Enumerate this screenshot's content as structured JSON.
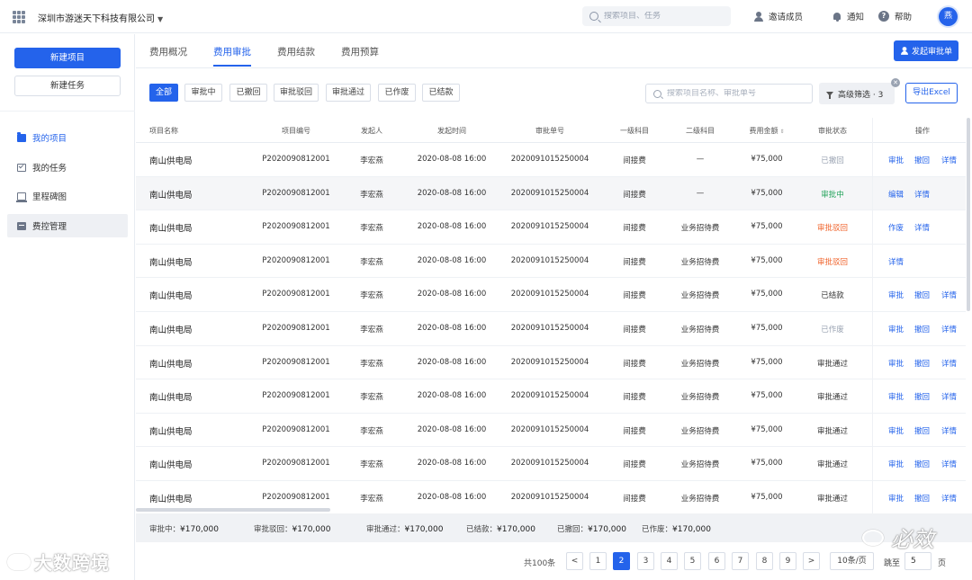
{
  "header": {
    "company": "深圳市游迷天下科技有限公司",
    "search_placeholder": "搜索项目、任务",
    "invite_label": "邀请成员",
    "notify_label": "通知",
    "help_label": "帮助",
    "avatar_text": "燕"
  },
  "sidebar": {
    "new_project": "新建项目",
    "new_task": "新建任务",
    "items": [
      {
        "label": "我的项目",
        "icon": "folder-icon"
      },
      {
        "label": "我的任务",
        "icon": "task-icon"
      },
      {
        "label": "里程碑图",
        "icon": "milestone-icon"
      },
      {
        "label": "费控管理",
        "icon": "cost-control-icon"
      }
    ]
  },
  "tabs": [
    {
      "label": "费用概况"
    },
    {
      "label": "费用审批"
    },
    {
      "label": "费用结款"
    },
    {
      "label": "费用预算"
    }
  ],
  "launch_button": "发起审批单",
  "filters": {
    "chips": [
      "全部",
      "审批中",
      "已撤回",
      "审批驳回",
      "审批通过",
      "已作废",
      "已结款"
    ],
    "search_placeholder": "搜索项目名称、审批单号",
    "advanced_label": "高级筛选 · 3",
    "export_label": "导出Excel"
  },
  "table": {
    "headers": [
      "项目名称",
      "项目编号",
      "发起人",
      "发起时间",
      "审批单号",
      "一级科目",
      "二级科目",
      "费用金额",
      "审批状态",
      "操作"
    ],
    "rows": [
      {
        "name": "南山供电局",
        "code": "P2020090812001",
        "person": "李宏燕",
        "time": "2020-08-08 16:00",
        "approval": "2020091015250004",
        "l1": "间接费",
        "l2": "—",
        "amount": "¥75,000",
        "status": "已撤回",
        "ops": [
          "审批",
          "撤回",
          "详情"
        ]
      },
      {
        "name": "南山供电局",
        "code": "P2020090812001",
        "person": "李宏燕",
        "time": "2020-08-08 16:00",
        "approval": "2020091015250004",
        "l1": "间接费",
        "l2": "—",
        "amount": "¥75,000",
        "status": "审批中",
        "ops": [
          "编辑",
          "详情"
        ]
      },
      {
        "name": "南山供电局",
        "code": "P2020090812001",
        "person": "李宏燕",
        "time": "2020-08-08 16:00",
        "approval": "2020091015250004",
        "l1": "间接费",
        "l2": "业务招待费",
        "amount": "¥75,000",
        "status": "审批驳回",
        "ops": [
          "作废",
          "详情"
        ]
      },
      {
        "name": "南山供电局",
        "code": "P2020090812001",
        "person": "李宏燕",
        "time": "2020-08-08 16:00",
        "approval": "2020091015250004",
        "l1": "间接费",
        "l2": "业务招待费",
        "amount": "¥75,000",
        "status": "审批驳回",
        "ops": [
          "详情"
        ]
      },
      {
        "name": "南山供电局",
        "code": "P2020090812001",
        "person": "李宏燕",
        "time": "2020-08-08 16:00",
        "approval": "2020091015250004",
        "l1": "间接费",
        "l2": "业务招待费",
        "amount": "¥75,000",
        "status": "已结款",
        "ops": [
          "审批",
          "撤回",
          "详情"
        ]
      },
      {
        "name": "南山供电局",
        "code": "P2020090812001",
        "person": "李宏燕",
        "time": "2020-08-08 16:00",
        "approval": "2020091015250004",
        "l1": "间接费",
        "l2": "业务招待费",
        "amount": "¥75,000",
        "status": "已作废",
        "ops": [
          "审批",
          "撤回",
          "详情"
        ]
      },
      {
        "name": "南山供电局",
        "code": "P2020090812001",
        "person": "李宏燕",
        "time": "2020-08-08 16:00",
        "approval": "2020091015250004",
        "l1": "间接费",
        "l2": "业务招待费",
        "amount": "¥75,000",
        "status": "审批通过",
        "ops": [
          "审批",
          "撤回",
          "详情"
        ]
      },
      {
        "name": "南山供电局",
        "code": "P2020090812001",
        "person": "李宏燕",
        "time": "2020-08-08 16:00",
        "approval": "2020091015250004",
        "l1": "间接费",
        "l2": "业务招待费",
        "amount": "¥75,000",
        "status": "审批通过",
        "ops": [
          "审批",
          "撤回",
          "详情"
        ]
      },
      {
        "name": "南山供电局",
        "code": "P2020090812001",
        "person": "李宏燕",
        "time": "2020-08-08 16:00",
        "approval": "2020091015250004",
        "l1": "间接费",
        "l2": "业务招待费",
        "amount": "¥75,000",
        "status": "审批通过",
        "ops": [
          "审批",
          "撤回",
          "详情"
        ]
      },
      {
        "name": "南山供电局",
        "code": "P2020090812001",
        "person": "李宏燕",
        "time": "2020-08-08 16:00",
        "approval": "2020091015250004",
        "l1": "间接费",
        "l2": "业务招待费",
        "amount": "¥75,000",
        "status": "审批通过",
        "ops": [
          "审批",
          "撤回",
          "详情"
        ]
      },
      {
        "name": "南山供电局",
        "code": "P2020090812001",
        "person": "李宏燕",
        "time": "2020-08-08 16:00",
        "approval": "2020091015250004",
        "l1": "间接费",
        "l2": "业务招待费",
        "amount": "¥75,000",
        "status": "审批通过",
        "ops": [
          "审批",
          "撤回",
          "详情"
        ]
      }
    ]
  },
  "status_colors": {
    "已撤回": "#9aa3b2",
    "审批中": "#22a35a",
    "审批驳回": "#f0642d",
    "已结款": "#333333",
    "已作废": "#9aa3b2",
    "审批通过": "#333333"
  },
  "summary": [
    {
      "label": "审批中：",
      "value": "¥170,000"
    },
    {
      "label": "审批驳回：",
      "value": "¥170,000"
    },
    {
      "label": "审批通过：",
      "value": "¥170,000"
    },
    {
      "label": "已结款：",
      "value": "¥170,000"
    },
    {
      "label": "已撤回：",
      "value": "¥170,000"
    },
    {
      "label": "已作废：",
      "value": "¥170,000"
    }
  ],
  "pagination": {
    "total": "共100条",
    "prev": "<",
    "next": ">",
    "pages": [
      "1",
      "2",
      "3",
      "4",
      "5",
      "6",
      "7",
      "8",
      "9"
    ],
    "current": "2",
    "page_size": "10条/页",
    "jump_label": "跳至",
    "jump_value": "5",
    "jump_unit": "页"
  },
  "watermarks": {
    "left": "大数跨境",
    "right": "必效"
  }
}
